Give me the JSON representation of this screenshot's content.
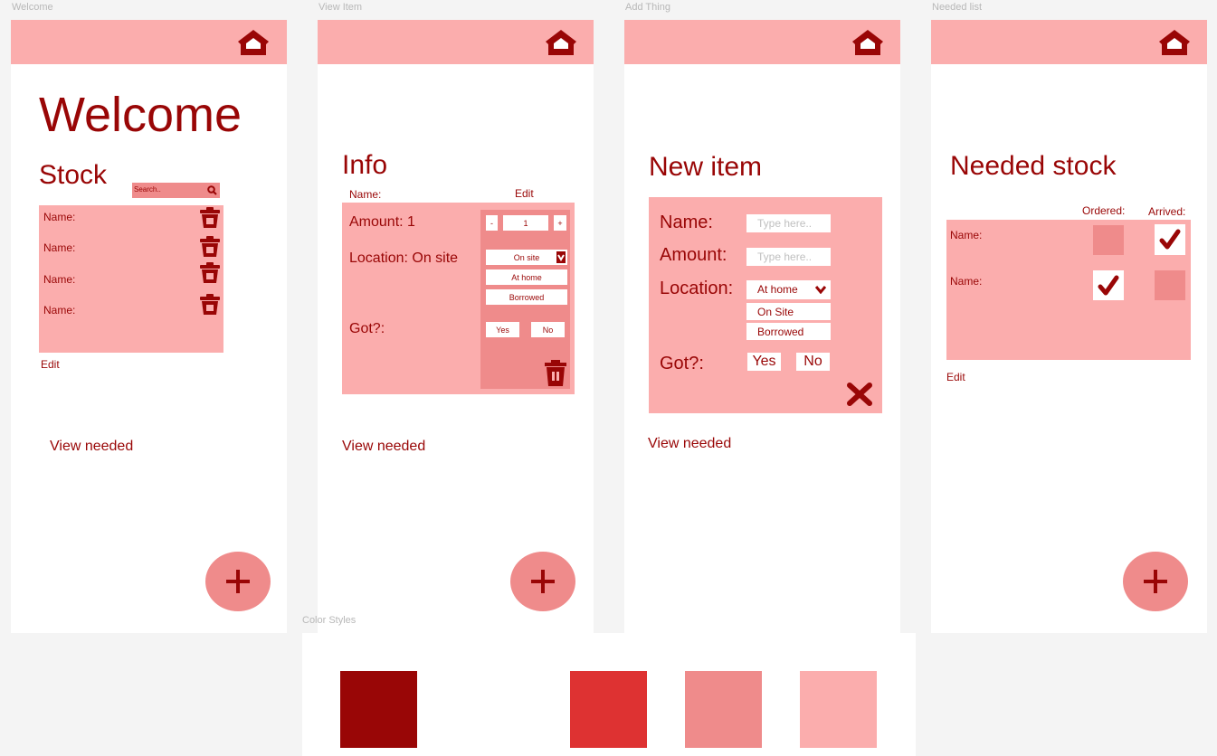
{
  "frames": {
    "welcome": {
      "label": "Welcome",
      "title": "Welcome",
      "section": "Stock",
      "search_placeholder": "Search..",
      "rows": [
        "Name:",
        "Name:",
        "Name:",
        "Name:"
      ],
      "edit": "Edit",
      "view_needed": "View needed",
      "fab_icon": "plus-icon"
    },
    "view_item": {
      "label": "View Item",
      "title": "Info",
      "name_label": "Name:",
      "edit": "Edit",
      "amount_label": "Amount: 1",
      "location_label": "Location: On site",
      "got_label": "Got?:",
      "stepper": {
        "minus": "-",
        "value": "1",
        "plus": "+"
      },
      "location_options": [
        "On site",
        "At home",
        "Borrowed"
      ],
      "got_options": [
        "Yes",
        "No"
      ],
      "view_needed": "View needed"
    },
    "add_thing": {
      "label": "Add Thing",
      "title": "New item",
      "name_label": "Name:",
      "amount_label": "Amount:",
      "location_label": "Location:",
      "got_label": "Got?:",
      "name_placeholder": "Type here..",
      "amount_placeholder": "Type here..",
      "location_options": [
        "At home",
        "On Site",
        "Borrowed"
      ],
      "got_options": [
        "Yes",
        "No"
      ],
      "view_needed": "View needed"
    },
    "needed_list": {
      "label": "Needed list",
      "title": "Needed stock",
      "col_ordered": "Ordered:",
      "col_arrived": "Arrived:",
      "rows": [
        {
          "name": "Name:",
          "ordered": false,
          "arrived": true
        },
        {
          "name": "Name:",
          "ordered": true,
          "arrived": false
        }
      ],
      "edit": "Edit"
    }
  },
  "color_styles": {
    "label": "Color Styles",
    "swatches": [
      "#990606",
      "#de3232",
      "#ef8b8b",
      "#fbadad"
    ]
  },
  "colors": {
    "dark": "#990606",
    "red": "#de3232",
    "mid": "#ef8b8b",
    "light": "#fbadad"
  }
}
